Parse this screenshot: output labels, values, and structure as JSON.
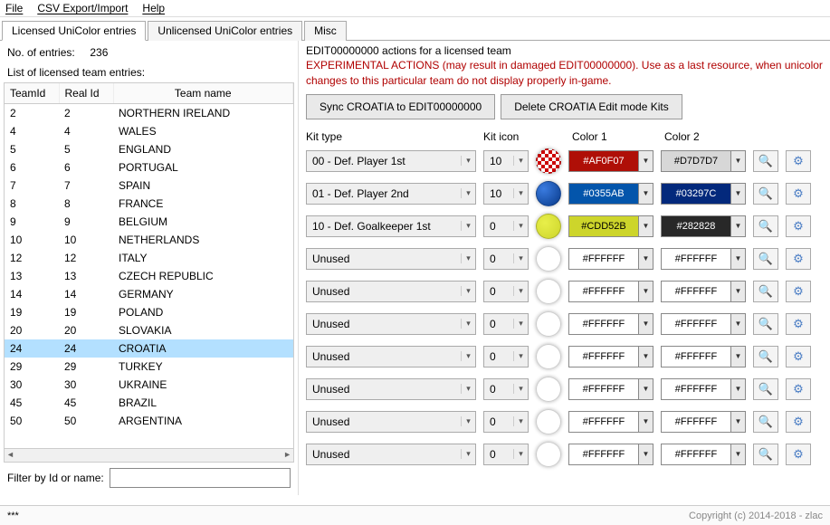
{
  "menu": {
    "file": "File",
    "csv": "CSV Export/Import",
    "help": "Help"
  },
  "tabs": {
    "t1": "Licensed UniColor entries",
    "t2": "Unlicensed UniColor entries",
    "t3": "Misc"
  },
  "left": {
    "entries_label": "No. of entries:",
    "entries_count": "236",
    "list_label": "List of licensed team entries:",
    "columns": {
      "c1": "TeamId",
      "c2": "Real Id",
      "c3": "Team name"
    },
    "rows": [
      {
        "teamId": "2",
        "realId": "2",
        "name": "NORTHERN IRELAND"
      },
      {
        "teamId": "4",
        "realId": "4",
        "name": "WALES"
      },
      {
        "teamId": "5",
        "realId": "5",
        "name": "ENGLAND"
      },
      {
        "teamId": "6",
        "realId": "6",
        "name": "PORTUGAL"
      },
      {
        "teamId": "7",
        "realId": "7",
        "name": "SPAIN"
      },
      {
        "teamId": "8",
        "realId": "8",
        "name": "FRANCE"
      },
      {
        "teamId": "9",
        "realId": "9",
        "name": "BELGIUM"
      },
      {
        "teamId": "10",
        "realId": "10",
        "name": "NETHERLANDS"
      },
      {
        "teamId": "12",
        "realId": "12",
        "name": "ITALY"
      },
      {
        "teamId": "13",
        "realId": "13",
        "name": "CZECH REPUBLIC"
      },
      {
        "teamId": "14",
        "realId": "14",
        "name": "GERMANY"
      },
      {
        "teamId": "19",
        "realId": "19",
        "name": "POLAND"
      },
      {
        "teamId": "20",
        "realId": "20",
        "name": "SLOVAKIA"
      },
      {
        "teamId": "24",
        "realId": "24",
        "name": "CROATIA",
        "selected": true
      },
      {
        "teamId": "29",
        "realId": "29",
        "name": "TURKEY"
      },
      {
        "teamId": "30",
        "realId": "30",
        "name": "UKRAINE"
      },
      {
        "teamId": "45",
        "realId": "45",
        "name": "BRAZIL"
      },
      {
        "teamId": "50",
        "realId": "50",
        "name": "ARGENTINA"
      }
    ],
    "filter_label": "Filter by Id or name:"
  },
  "right": {
    "edit_label": "EDIT00000000 actions for a licensed team",
    "warning": "EXPERIMENTAL ACTIONS (may result in damaged EDIT00000000). Use as a last resource, when unicolor changes to this particular team do not display properly in-game.",
    "btn_sync": "Sync CROATIA to EDIT00000000",
    "btn_delete": "Delete CROATIA Edit mode Kits",
    "headers": {
      "h1": "Kit type",
      "h2": "Kit icon",
      "h3": "Color 1",
      "h4": "Color 2"
    },
    "kits": [
      {
        "type": "00 - Def. Player 1st",
        "icon": "10",
        "swatch": "repeating-conic-gradient(#c00 0 25%, #fff 0 50%) 50% / 8px 8px",
        "c1": "#AF0F07",
        "c1fg": "#fff",
        "c2": "#D7D7D7",
        "c2fg": "#000"
      },
      {
        "type": "01 - Def. Player 2nd",
        "icon": "10",
        "swatch": "radial-gradient(circle at 30% 30%, #3a7be0, #083a8a)",
        "c1": "#0355AB",
        "c1fg": "#fff",
        "c2": "#03297C",
        "c2fg": "#fff"
      },
      {
        "type": "10 - Def. Goalkeeper 1st",
        "icon": "0",
        "swatch": "radial-gradient(circle at 35% 35%, #e8ef4a, #cdd52b)",
        "c1": "#CDD52B",
        "c1fg": "#000",
        "c2": "#282828",
        "c2fg": "#fff"
      },
      {
        "type": "Unused",
        "icon": "0",
        "swatch": "radial-gradient(circle at 35% 35%, #fff, #fff)",
        "c1": "#FFFFFF",
        "c1fg": "#000",
        "c2": "#FFFFFF",
        "c2fg": "#000"
      },
      {
        "type": "Unused",
        "icon": "0",
        "swatch": "radial-gradient(circle at 35% 35%, #fff, #fff)",
        "c1": "#FFFFFF",
        "c1fg": "#000",
        "c2": "#FFFFFF",
        "c2fg": "#000"
      },
      {
        "type": "Unused",
        "icon": "0",
        "swatch": "radial-gradient(circle at 35% 35%, #fff, #fff)",
        "c1": "#FFFFFF",
        "c1fg": "#000",
        "c2": "#FFFFFF",
        "c2fg": "#000"
      },
      {
        "type": "Unused",
        "icon": "0",
        "swatch": "radial-gradient(circle at 35% 35%, #fff, #fff)",
        "c1": "#FFFFFF",
        "c1fg": "#000",
        "c2": "#FFFFFF",
        "c2fg": "#000"
      },
      {
        "type": "Unused",
        "icon": "0",
        "swatch": "radial-gradient(circle at 35% 35%, #fff, #fff)",
        "c1": "#FFFFFF",
        "c1fg": "#000",
        "c2": "#FFFFFF",
        "c2fg": "#000"
      },
      {
        "type": "Unused",
        "icon": "0",
        "swatch": "radial-gradient(circle at 35% 35%, #fff, #fff)",
        "c1": "#FFFFFF",
        "c1fg": "#000",
        "c2": "#FFFFFF",
        "c2fg": "#000"
      },
      {
        "type": "Unused",
        "icon": "0",
        "swatch": "radial-gradient(circle at 35% 35%, #fff, #fff)",
        "c1": "#FFFFFF",
        "c1fg": "#000",
        "c2": "#FFFFFF",
        "c2fg": "#000"
      }
    ]
  },
  "statusbar": {
    "left": "***",
    "right": "Copyright (c) 2014-2018 - zlac"
  }
}
